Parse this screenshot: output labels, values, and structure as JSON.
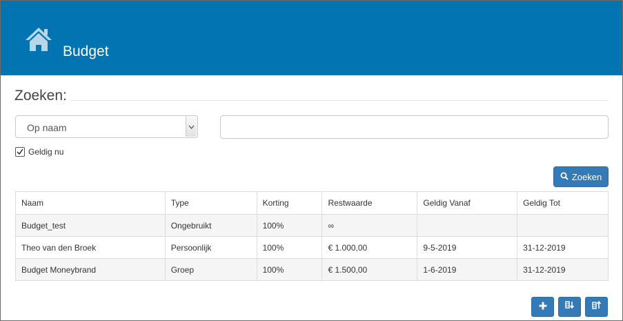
{
  "header": {
    "title": "Budget",
    "icon": "home-icon",
    "background": "#0274b2"
  },
  "search": {
    "heading": "Zoeken:",
    "select_value": "Op naam",
    "input_value": "",
    "checkbox_label": "Geldig nu",
    "checkbox_checked": true,
    "button_label": "Zoeken"
  },
  "table": {
    "columns": [
      "Naam",
      "Type",
      "Korting",
      "Restwaarde",
      "Geldig Vanaf",
      "Geldig Tot"
    ],
    "rows": [
      [
        "Budget_test",
        "Ongebruikt",
        "100%",
        "∞",
        "",
        ""
      ],
      [
        "Theo van den Broek",
        "Persoonlijk",
        "100%",
        "€ 1.000,00",
        "9-5-2019",
        "31-12-2019"
      ],
      [
        "Budget Moneybrand",
        "Groep",
        "100%",
        "€ 1.500,00",
        "1-6-2019",
        "31-12-2019"
      ]
    ]
  },
  "actions": {
    "add_icon": "plus-icon",
    "import_icon": "import-icon",
    "export_icon": "export-icon"
  },
  "colors": {
    "primary": "#337ab7",
    "header": "#0274b2"
  }
}
